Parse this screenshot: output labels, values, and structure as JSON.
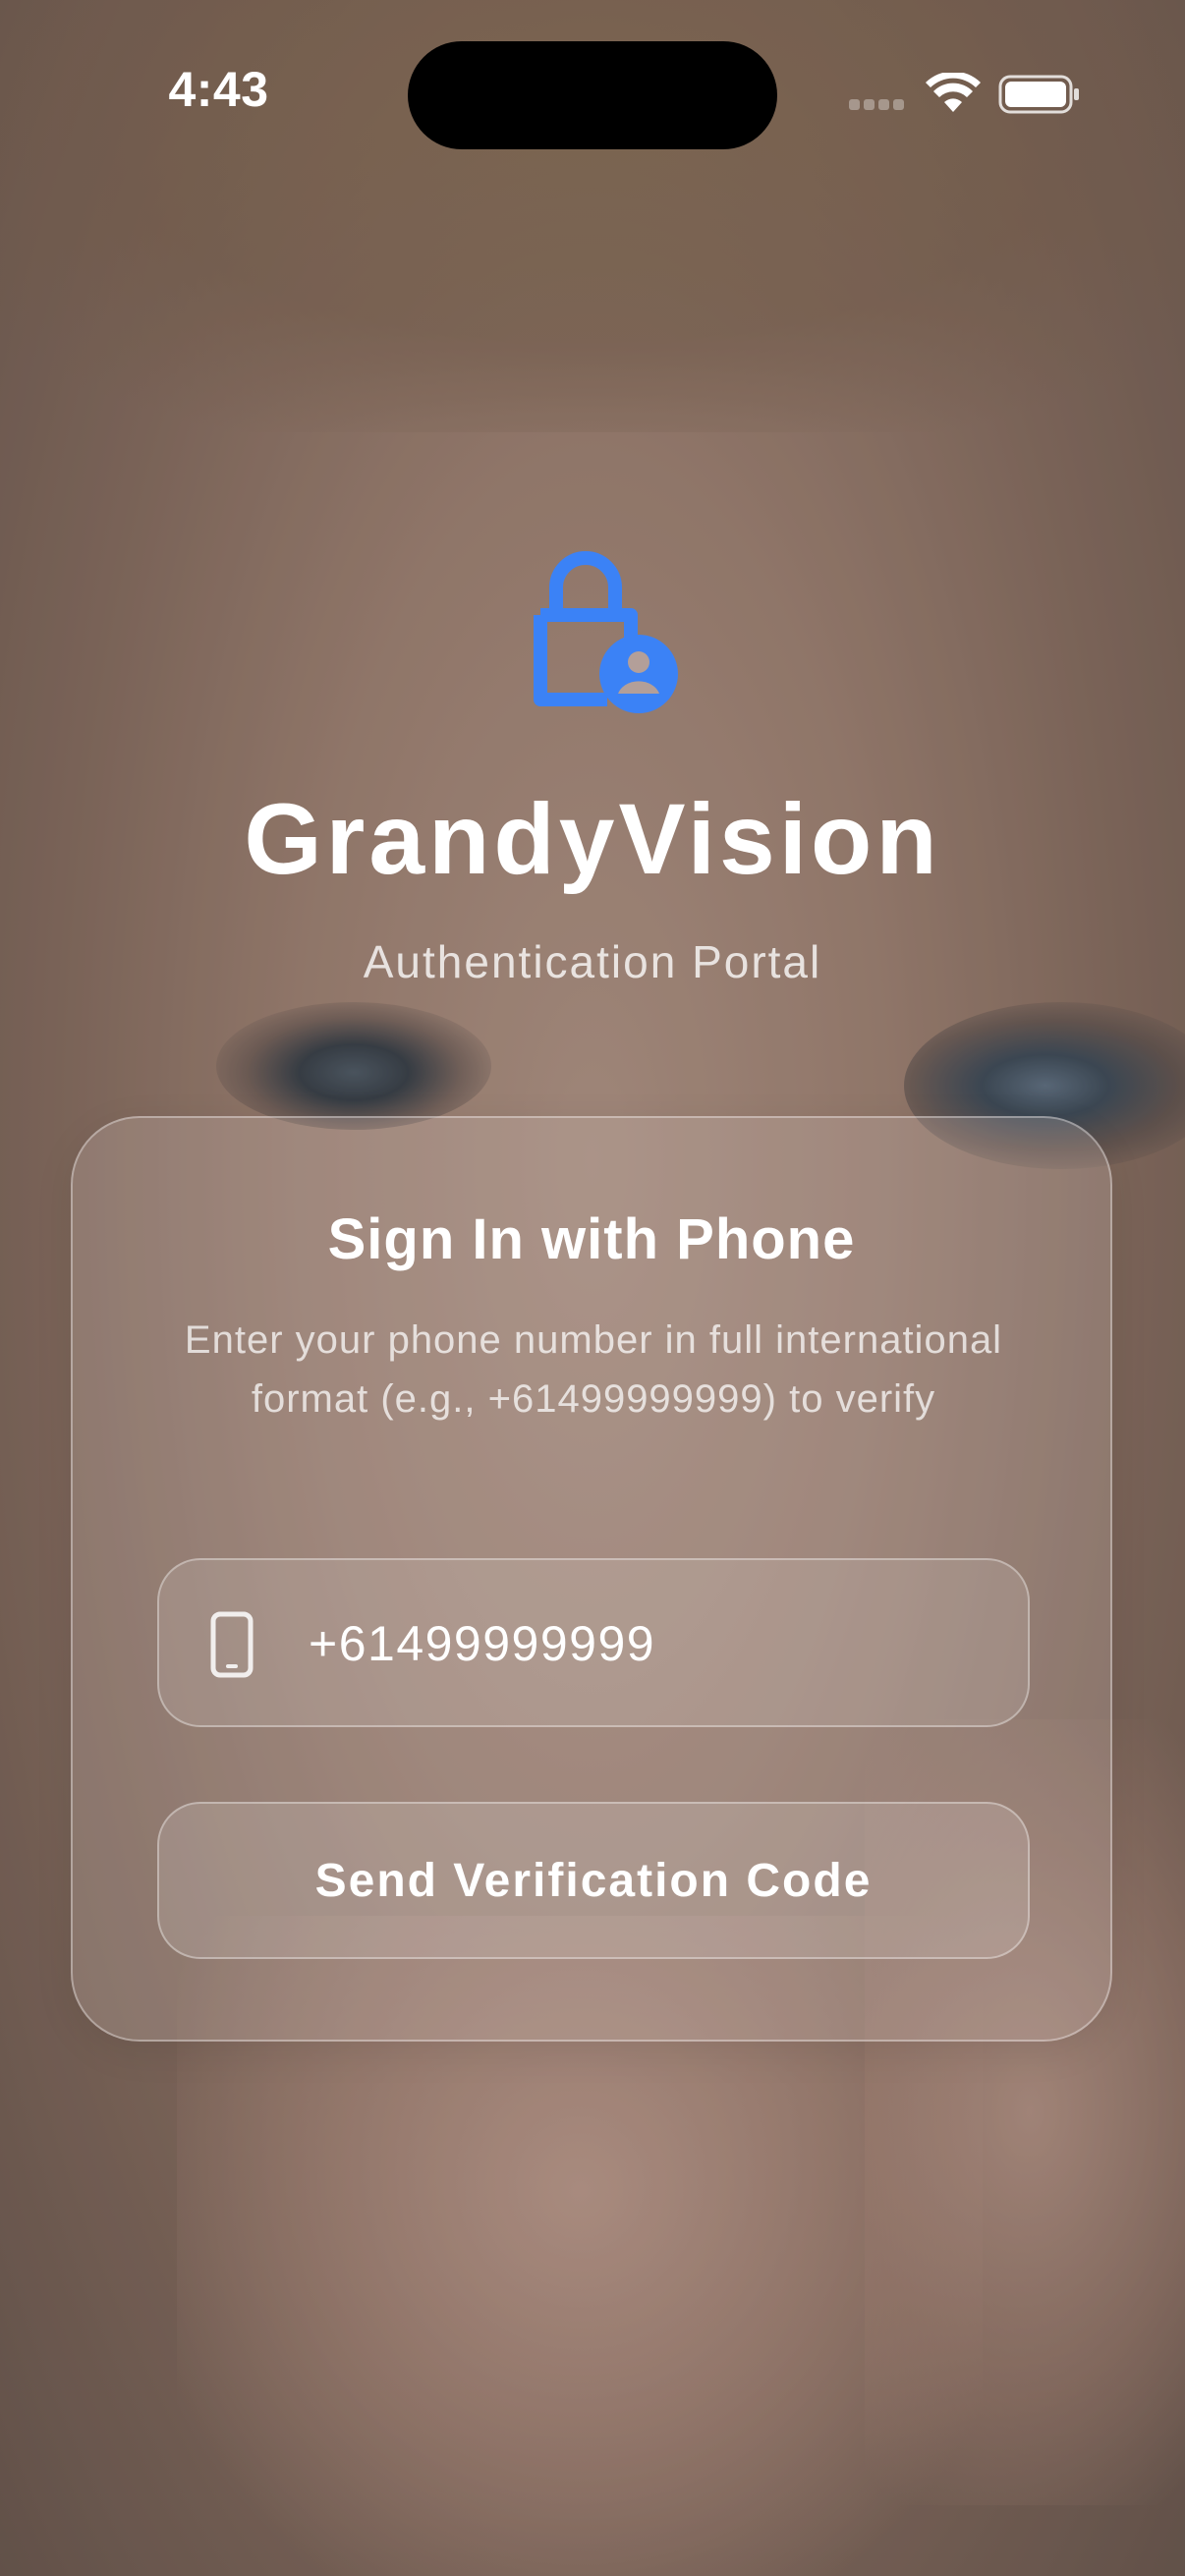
{
  "status_bar": {
    "time": "4:43"
  },
  "header": {
    "icon": "lock-person-icon",
    "title": "GrandyVision",
    "subtitle": "Authentication Portal"
  },
  "sign_in_card": {
    "title": "Sign In with Phone",
    "description": "Enter your phone number in full international format (e.g., +61499999999) to verify",
    "phone_field": {
      "icon": "smartphone-icon",
      "value": "+61499999999"
    },
    "send_button_label": "Send Verification Code"
  },
  "colors": {
    "accent": "#3B82F6",
    "text_primary": "#FFFFFF"
  }
}
